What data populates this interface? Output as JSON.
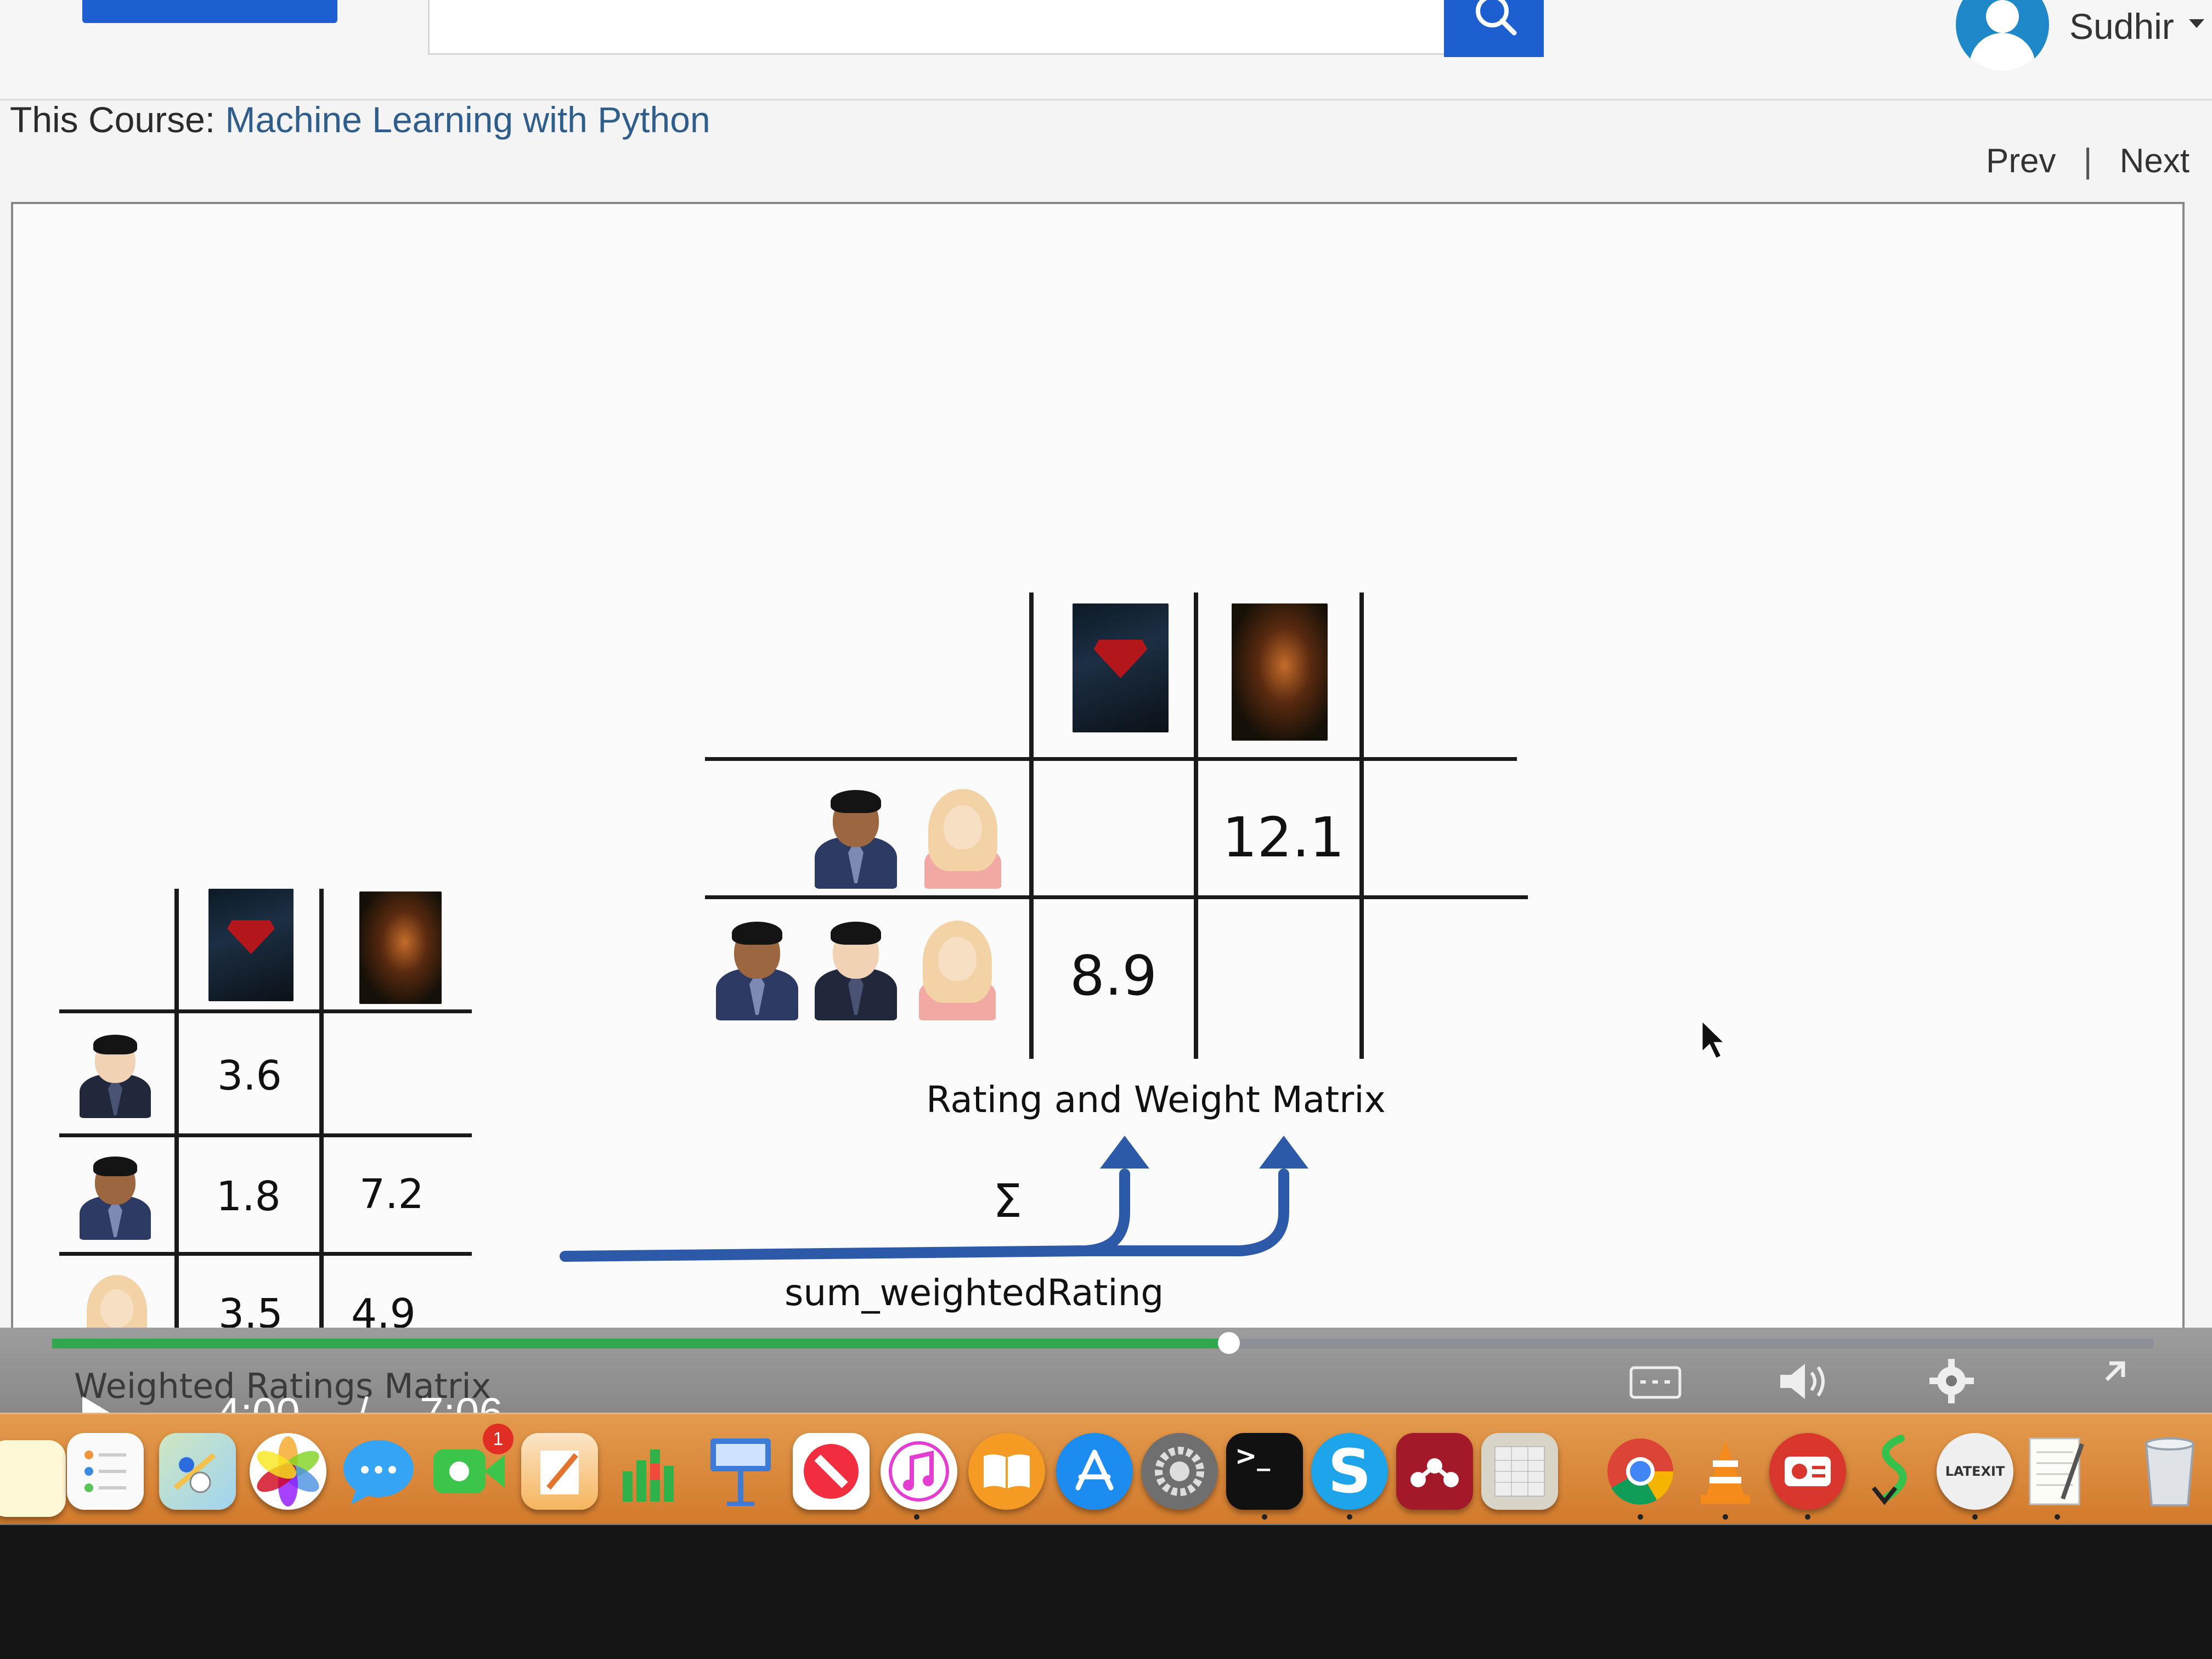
{
  "header": {
    "user_name": "Sudhir",
    "course_prefix": "This Course: ",
    "course_name": "Machine Learning with Python",
    "prev_label": "Prev",
    "nav_separator": "|",
    "next_label": "Next"
  },
  "slide": {
    "rating_weight_matrix": {
      "title": "Rating and Weight Matrix",
      "row1_col2": "12.1",
      "row2_col1": "8.9"
    },
    "sum_symbol": "Σ",
    "sum_label": "sum_weightedRating",
    "weighted_ratings_matrix": {
      "title": "Weighted Ratings Matrix",
      "rows": [
        {
          "c1": "3.6",
          "c2": ""
        },
        {
          "c1": "1.8",
          "c2": "7.2"
        },
        {
          "c1": "3.5",
          "c2": "4.9"
        }
      ]
    },
    "colors": {
      "arrow": "#2c5aa8",
      "progress": "#2fa84f",
      "accent": "#1d5fd1"
    }
  },
  "player": {
    "current_time": "4:00",
    "time_separator": "/",
    "duration": "7:06",
    "progress_fraction": 0.56
  },
  "dock": {
    "apps": [
      "notes-icon",
      "reminders-icon",
      "maps-icon",
      "photos-icon",
      "messages-icon",
      "facetime-icon",
      "pages-icon",
      "numbers-icon",
      "keynote-icon",
      "news-icon",
      "itunes-icon",
      "ibooks-icon",
      "app-store-icon",
      "system-preferences-icon",
      "terminal-icon",
      "skype-icon",
      "mendeley-icon",
      "calendar-icon",
      "chrome-icon",
      "vlc-icon",
      "radio-icon",
      "mouse-icon",
      "latexit-icon",
      "textedit-icon",
      "trash-icon"
    ],
    "facetime_badge": "1",
    "terminal_prompt": ">_",
    "skype_letter": "S",
    "latexit_label": "LATEXIT"
  }
}
